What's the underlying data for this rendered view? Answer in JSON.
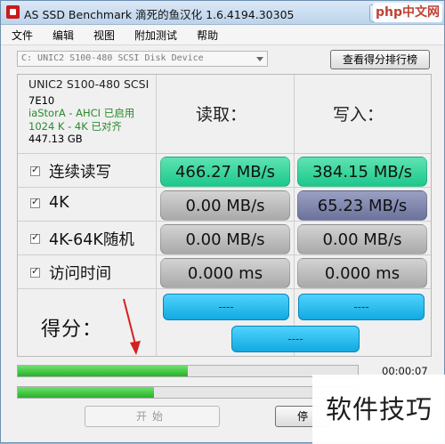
{
  "window": {
    "title": "AS SSD Benchmark 滴死的鱼汉化 1.6.4194.30305",
    "buttons": {
      "minimize": "–",
      "maximize": "□",
      "close": "✕"
    },
    "overlay_logo": "php中文网"
  },
  "menu": [
    "文件",
    "编辑",
    "视图",
    "附加测试",
    "帮助"
  ],
  "device": {
    "selected": "C: UNIC2 S100-480 SCSI Disk Device",
    "compare_button": "查看得分排行榜"
  },
  "drive_info": {
    "model": "UNIC2 S100-480 SCSI",
    "firmware": "7E10",
    "driver": "iaStorA - AHCI 已启用",
    "alignment": "1024 K - 4K 已对齐",
    "size": "447.13 GB"
  },
  "columns": {
    "read": "读取：",
    "write": "写入："
  },
  "rows": [
    {
      "label": "连续读写",
      "checked": true,
      "read": "466.27 MB/s",
      "write": "384.15 MB/s"
    },
    {
      "label": "4K",
      "checked": true,
      "read": "0.00 MB/s",
      "write": "65.23 MB/s"
    },
    {
      "label": "4K-64K随机",
      "checked": true,
      "read": "0.00 MB/s",
      "write": "0.00 MB/s"
    },
    {
      "label": "访问时间",
      "checked": true,
      "read": "0.000 ms",
      "write": "0.000 ms"
    }
  ],
  "score": {
    "label": "得分：",
    "read": "----",
    "write": "----",
    "total": "----"
  },
  "progress": {
    "elapsed": "00:00:07",
    "bar1_fraction": 0.5,
    "bar2_fraction": 0.4
  },
  "buttons": {
    "start": "开始",
    "stop": "停"
  },
  "colors": {
    "highlight_green": "#1cc88c",
    "score_blue": "#12a9e0",
    "navy": "#6c739c"
  },
  "watermark": "软件技巧"
}
